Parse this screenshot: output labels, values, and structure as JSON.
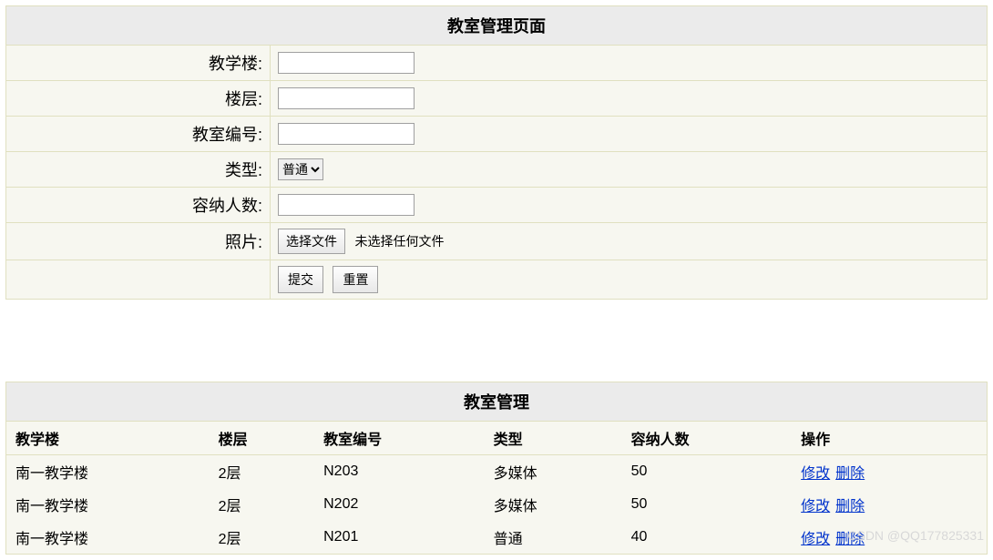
{
  "form": {
    "title": "教室管理页面",
    "fields": {
      "building_label": "教学楼:",
      "floor_label": "楼层:",
      "room_no_label": "教室编号:",
      "type_label": "类型:",
      "type_selected": "普通",
      "capacity_label": "容纳人数:",
      "photo_label": "照片:",
      "choose_file_button": "选择文件",
      "no_file_text": "未选择任何文件"
    },
    "buttons": {
      "submit": "提交",
      "reset": "重置"
    }
  },
  "list": {
    "title": "教室管理",
    "columns": {
      "building": "教学楼",
      "floor": "楼层",
      "room_no": "教室编号",
      "type": "类型",
      "capacity": "容纳人数",
      "action": "操作"
    },
    "actions": {
      "edit": "修改",
      "delete": "删除"
    },
    "rows": [
      {
        "building": "南一教学楼",
        "floor": "2层",
        "room_no": "N203",
        "type": "多媒体",
        "capacity": "50"
      },
      {
        "building": "南一教学楼",
        "floor": "2层",
        "room_no": "N202",
        "type": "多媒体",
        "capacity": "50"
      },
      {
        "building": "南一教学楼",
        "floor": "2层",
        "room_no": "N201",
        "type": "普通",
        "capacity": "40"
      }
    ]
  },
  "watermark": "CSDN @QQ177825331"
}
